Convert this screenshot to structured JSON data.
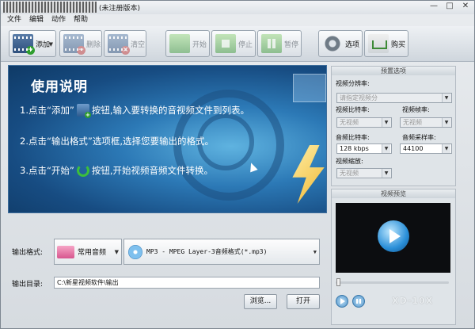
{
  "window": {
    "title": "(未注册版本)",
    "controls": [
      "—",
      "□",
      "✕"
    ]
  },
  "menu": [
    "文件",
    "编辑",
    "动作",
    "帮助"
  ],
  "toolbar": {
    "add": "添加",
    "delete": "删除",
    "clear": "清空",
    "start": "开始",
    "stop": "停止",
    "pause": "暂停",
    "options": "选项",
    "buy": "购买"
  },
  "banner": {
    "title": "使用说明",
    "step1_a": "1.点击“添加”",
    "step1_b": "按钮,输入要转换的音视频文件到列表。",
    "step2": "2.点击“输出格式”选项框,选择您要输出的格式。",
    "step3_a": "3.点击“开始”",
    "step3_b": "按钮,开始视频音频文件转换。"
  },
  "presets": {
    "header": "预置选项",
    "video_res_label": "视频分辨率:",
    "video_res_value": "请指定视频分",
    "video_bitrate_label": "视频比特率:",
    "video_bitrate_value": "无视频",
    "video_fps_label": "视频帧率:",
    "video_fps_value": "无视频",
    "audio_bitrate_label": "音频比特率:",
    "audio_bitrate_value": "128 kbps",
    "audio_rate_label": "音频采样率:",
    "audio_rate_value": "44100",
    "video_zoom_label": "视频缩放:",
    "video_zoom_value": "无视频"
  },
  "preview": {
    "header": "视频预览",
    "watermark": "XD-10X"
  },
  "output": {
    "format_label": "输出格式:",
    "category": "常用音频",
    "format": "MP3 - MPEG Layer-3音频格式(*.mp3)",
    "dir_label": "输出目录:",
    "dir_value": "C:\\新星视频软件\\输出",
    "browse": "浏览...",
    "open": "打开"
  }
}
